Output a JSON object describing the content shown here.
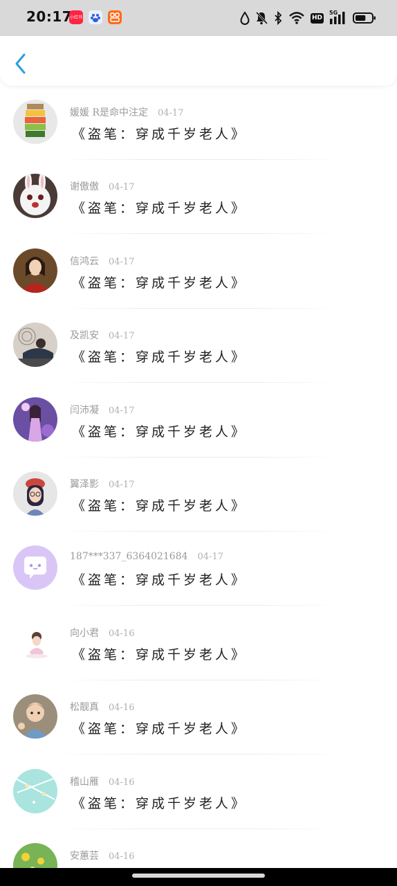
{
  "status_bar": {
    "time": "20:17",
    "app_badge_1": "小红书",
    "network_hd": "HD",
    "network_gen": "5G",
    "icons": [
      "water-drop-icon",
      "bell-mute-icon",
      "bluetooth-icon",
      "wifi-icon",
      "hd-icon",
      "signal-5g-icon",
      "battery-icon"
    ],
    "battery_level": 0.65
  },
  "header": {
    "back_icon": "chevron-left-icon",
    "accent_color": "#2a9fd6"
  },
  "items": [
    {
      "user": "媛媛 R是命中注定",
      "date": "04-17",
      "title": "《盗笔：穿成千岁老人》"
    },
    {
      "user": "谢傲傲",
      "date": "04-17",
      "title": "《盗笔：穿成千岁老人》"
    },
    {
      "user": "信鸿云",
      "date": "04-17",
      "title": "《盗笔：穿成千岁老人》"
    },
    {
      "user": "及凯安",
      "date": "04-17",
      "title": "《盗笔：穿成千岁老人》"
    },
    {
      "user": "闫沛凝",
      "date": "04-17",
      "title": "《盗笔：穿成千岁老人》"
    },
    {
      "user": "翼泽影",
      "date": "04-17",
      "title": "《盗笔：穿成千岁老人》"
    },
    {
      "user": "187***337_6364021684",
      "date": "04-17",
      "title": "《盗笔：穿成千岁老人》"
    },
    {
      "user": "向小君",
      "date": "04-16",
      "title": "《盗笔：穿成千岁老人》"
    },
    {
      "user": "松靓真",
      "date": "04-16",
      "title": "《盗笔：穿成千岁老人》"
    },
    {
      "user": "稽山雁",
      "date": "04-16",
      "title": "《盗笔：穿成千岁老人》"
    },
    {
      "user": "安蕙芸",
      "date": "04-16",
      "title": ""
    }
  ]
}
